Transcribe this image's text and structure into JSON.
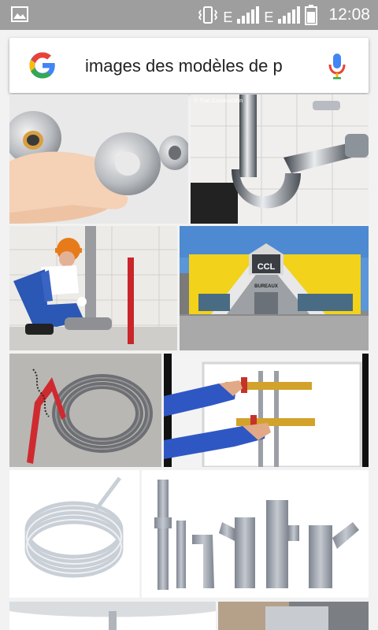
{
  "status_bar": {
    "time": "12:08",
    "network_1": "E",
    "network_2": "E",
    "icons": [
      "image-notification-icon",
      "vibrate-icon",
      "signal-icon",
      "signal-icon",
      "battery-icon"
    ]
  },
  "search": {
    "query": "images des modèles de p",
    "logo": "google-logo",
    "voice_icon": "mic-icon"
  },
  "images": {
    "watermark": "© Truc Construction",
    "store_sign": "CCL",
    "store_subsign": "BUREAUX"
  },
  "colors": {
    "status_bar": "#9e9e9e",
    "google_blue": "#4285f4",
    "google_red": "#ea4335",
    "google_yellow": "#fbbc05",
    "google_green": "#34a853"
  }
}
